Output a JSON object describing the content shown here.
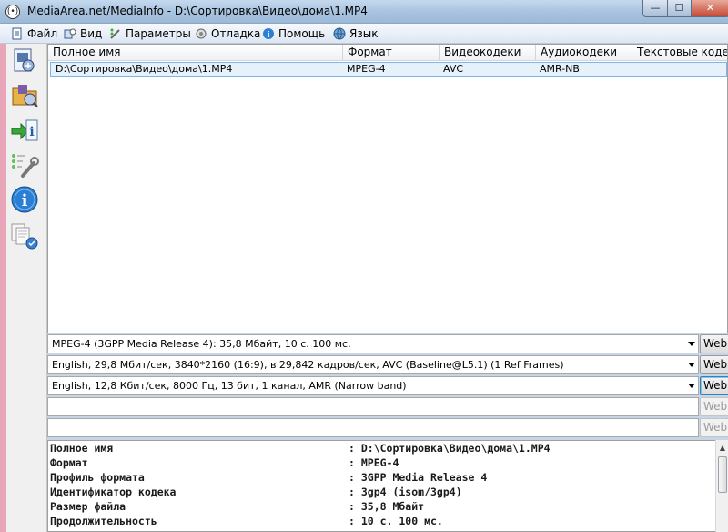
{
  "window": {
    "title": "MediaArea.net/MediaInfo - D:\\Сортировка\\Видео\\дома\\1.MP4",
    "app_icon": "(•)",
    "min_glyph": "—",
    "max_glyph": "☐",
    "close_glyph": "✕"
  },
  "menu": [
    {
      "label": "Файл",
      "icon": "file-icon"
    },
    {
      "label": "Вид",
      "icon": "view-icon"
    },
    {
      "label": "Параметры",
      "icon": "options-icon"
    },
    {
      "label": "Отладка",
      "icon": "debug-icon"
    },
    {
      "label": "Помощь",
      "icon": "help-icon"
    },
    {
      "label": "Язык",
      "icon": "language-icon"
    }
  ],
  "toolbar": [
    {
      "icon": "open-file-icon"
    },
    {
      "icon": "open-folder-icon"
    },
    {
      "icon": "export-icon"
    },
    {
      "icon": "options-wrench-icon"
    },
    {
      "icon": "info-icon"
    },
    {
      "icon": "about-documents-icon"
    }
  ],
  "list": {
    "columns": [
      "Полное имя",
      "Формат",
      "Видеокодеки",
      "Аудиокодеки",
      "Текстовые кодеки"
    ],
    "rows": [
      [
        "D:\\Сортировка\\Видео\\дома\\1.MP4",
        "MPEG-4",
        "AVC",
        "AMR-NB",
        ""
      ]
    ]
  },
  "streams": {
    "general": "MPEG-4 (3GPP Media Release 4): 35,8 Мбайт, 10 с. 100 мс.",
    "video": "English, 29,8 Мбит/сек, 3840*2160 (16:9), в 29,842 кадров/сек, AVC (Baseline@L5.1) (1 Ref Frames)",
    "audio": "English, 12,8 Кбит/сек, 8000 Гц, 13 бит, 1 канал, AMR (Narrow band)",
    "text": "",
    "other": "",
    "web_label": "Web"
  },
  "details": [
    {
      "key": "Полное имя",
      "value": ": D:\\Сортировка\\Видео\\дома\\1.MP4"
    },
    {
      "key": "Формат",
      "value": ": MPEG-4"
    },
    {
      "key": "Профиль формата",
      "value": ": 3GPP Media Release 4"
    },
    {
      "key": "Идентификатор кодека",
      "value": ": 3gp4 (isom/3gp4)"
    },
    {
      "key": "Размер файла",
      "value": ": 35,8 Мбайт"
    },
    {
      "key": "Продолжительность",
      "value": ": 10 с. 100 мс."
    }
  ],
  "colors": {
    "titlebar": "#a9c4e0",
    "selection": "#e5f1fb",
    "selection_border": "#7eb4ea",
    "close_button": "#c44a35"
  }
}
